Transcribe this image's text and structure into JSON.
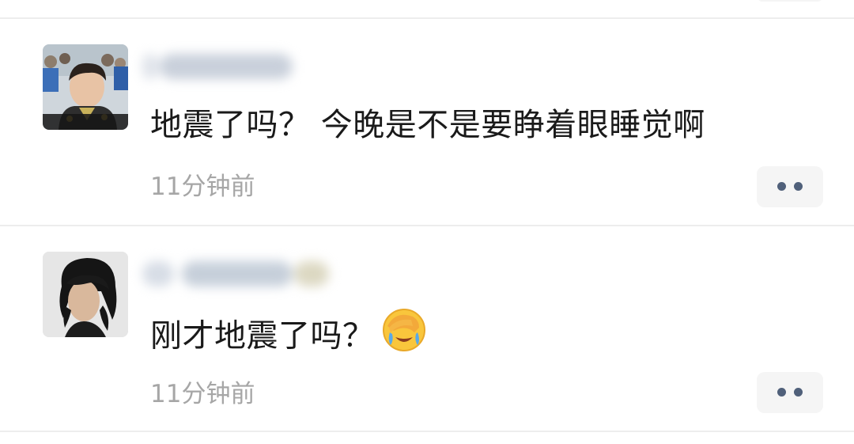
{
  "comments": [
    {
      "text": "地震了吗？  今晚是不是要睁着眼睡觉啊",
      "time": "11分钟前",
      "avatar_icon": "avatar-photo-young-man",
      "emoji": ""
    },
    {
      "text": "刚才地震了吗？",
      "time": "11分钟前",
      "avatar_icon": "avatar-photo-curly-hair",
      "emoji": "face-palm-crying-icon"
    }
  ],
  "colors": {
    "text": "#1a1a1a",
    "timestamp": "#a6a6a6",
    "divider": "#ededed",
    "more_button_bg": "#f5f5f5",
    "dots": "#50607a"
  }
}
